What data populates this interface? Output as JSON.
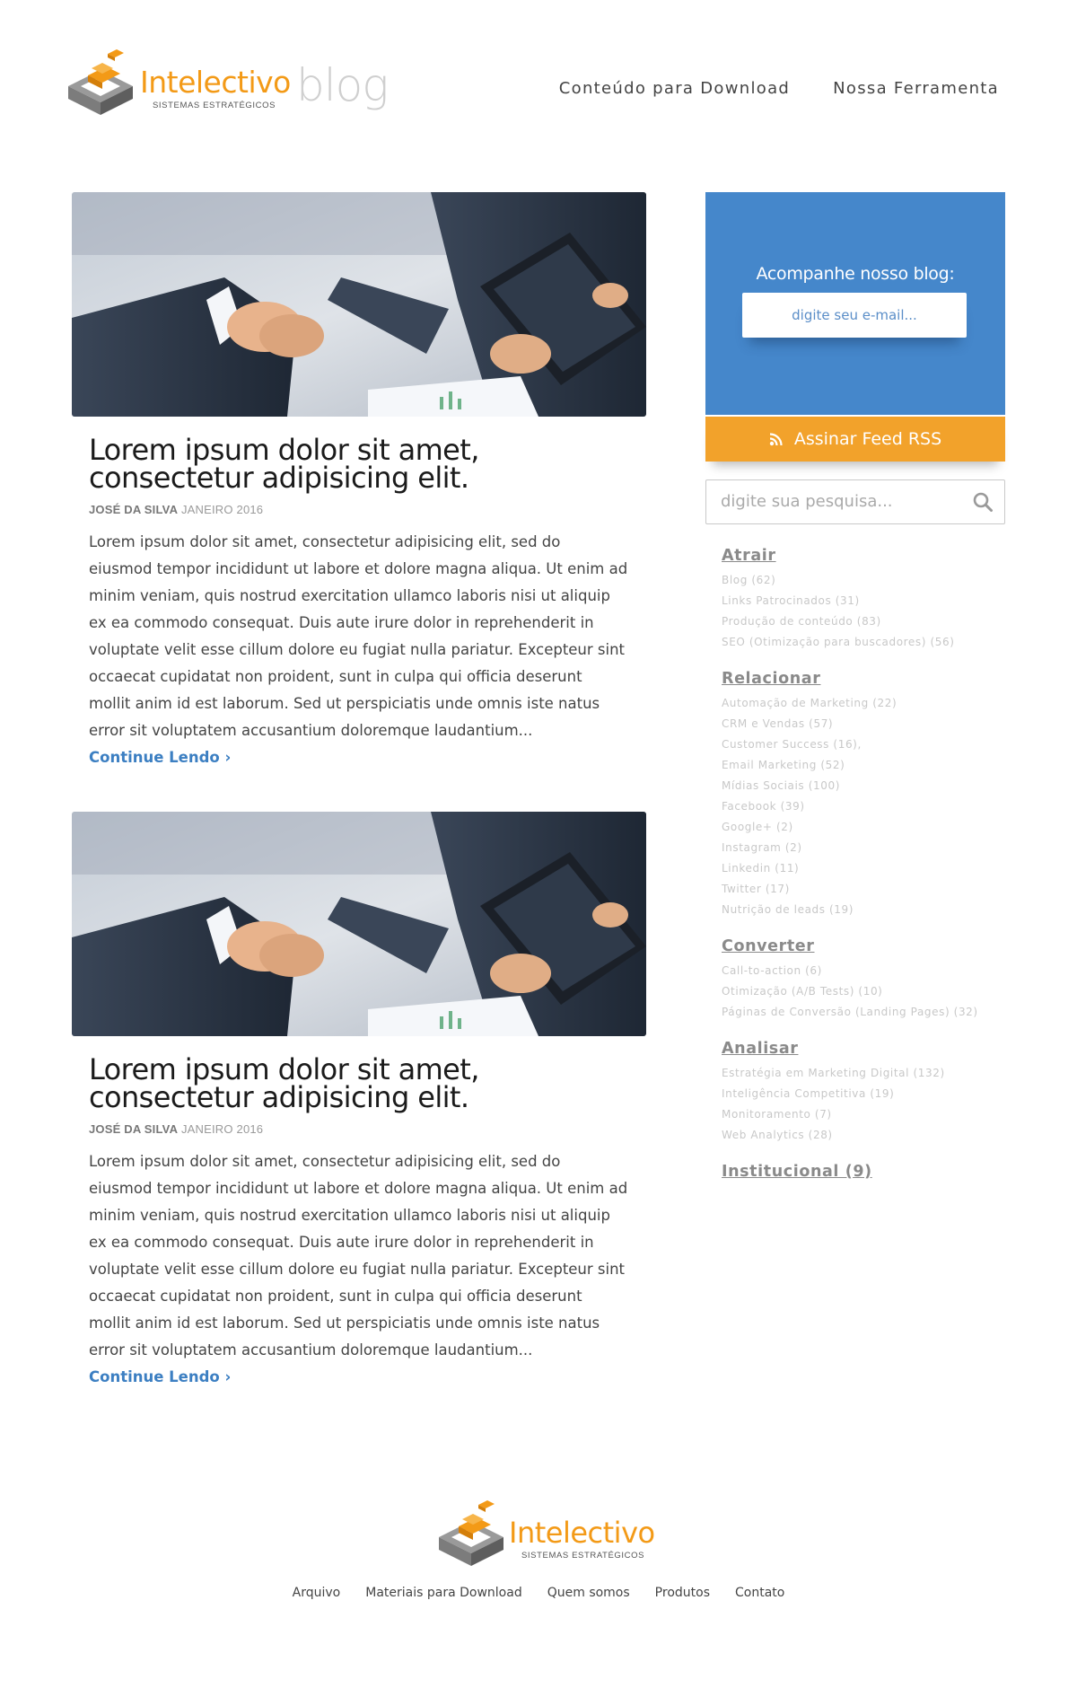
{
  "header": {
    "brand": "Intelectivo",
    "brand_tagline": "SISTEMAS ESTRATÉGICOS",
    "section": "blog",
    "nav": [
      {
        "label": "Conteúdo para Download"
      },
      {
        "label": "Nossa Ferramenta"
      }
    ]
  },
  "posts": [
    {
      "title": "Lorem ipsum dolor sit amet, consectetur adipisicing elit.",
      "author": "JOSÉ DA SILVA",
      "date": "JANEIRO 2016",
      "excerpt": "Lorem ipsum dolor sit amet, consectetur adipisicing elit, sed do eiusmod tempor incididunt ut labore et dolore magna aliqua. Ut enim ad minim veniam, quis nostrud exercitation ullamco laboris nisi ut aliquip ex ea commodo consequat. Duis aute irure dolor in reprehenderit in voluptate velit esse cillum dolore eu fugiat nulla pariatur. Excepteur sint occaecat cupidatat non proident, sunt in culpa qui officia deserunt mollit anim id est laborum. Sed ut perspiciatis unde omnis iste natus error sit voluptatem accusantium doloremque laudantium...",
      "read_more": "Continue Lendo ›",
      "image": "handshake-tablet-photo"
    },
    {
      "title": "Lorem ipsum dolor sit amet, consectetur adipisicing elit.",
      "author": "JOSÉ DA SILVA",
      "date": "JANEIRO 2016",
      "excerpt": "Lorem ipsum dolor sit amet, consectetur adipisicing elit, sed do eiusmod tempor incididunt ut labore et dolore magna aliqua. Ut enim ad minim veniam, quis nostrud exercitation ullamco laboris nisi ut aliquip ex ea commodo consequat. Duis aute irure dolor in reprehenderit in voluptate velit esse cillum dolore eu fugiat nulla pariatur. Excepteur sint occaecat cupidatat non proident, sunt in culpa qui officia deserunt mollit anim id est laborum. Sed ut perspiciatis unde omnis iste natus error sit voluptatem accusantium doloremque laudantium...",
      "read_more": "Continue Lendo ›",
      "image": "handshake-tablet-photo"
    }
  ],
  "sidebar": {
    "subscribe": {
      "title": "Acompanhe nosso blog:",
      "email_placeholder": "digite seu e-mail...",
      "email_value": ""
    },
    "rss": {
      "label": "Assinar Feed RSS",
      "icon": "rss-icon"
    },
    "search": {
      "placeholder": "digite sua pesquisa...",
      "value": "",
      "icon": "search-icon"
    },
    "categories": [
      {
        "name": "Atrair",
        "items": [
          "Blog (62)",
          "Links Patrocinados (31)",
          "Produção de conteúdo (83)",
          "SEO (Otimização para buscadores) (56)"
        ]
      },
      {
        "name": "Relacionar",
        "items": [
          "Automação de Marketing (22)",
          "CRM e Vendas (57)",
          "Customer Success (16),",
          "Email Marketing (52)",
          "Mídias Sociais (100)",
          "Facebook (39)",
          "Google+ (2)",
          "Instagram (2)",
          "Linkedin (11)",
          "Twitter (17)",
          "Nutrição de leads (19)"
        ]
      },
      {
        "name": "Converter",
        "items": [
          "Call-to-action (6)",
          "Otimização (A/B Tests) (10)",
          "Páginas de Conversão (Landing Pages) (32)"
        ]
      },
      {
        "name": "Analisar",
        "items": [
          "Estratégia em Marketing Digital (132)",
          "Inteligência Competitiva (19)",
          "Monitoramento (7)",
          "Web Analytics (28)"
        ]
      }
    ],
    "institucional": "Institucional (9)"
  },
  "footer": {
    "brand": "Intelectivo",
    "brand_tagline": "SISTEMAS ESTRATÉGICOS",
    "links": [
      {
        "label": "Arquivo"
      },
      {
        "label": "Materiais para Download"
      },
      {
        "label": "Quem somos"
      },
      {
        "label": "Produtos"
      },
      {
        "label": "Contato"
      }
    ]
  },
  "colors": {
    "brand_orange": "#f39a17",
    "subscribe_blue": "#4587cb",
    "rss_orange": "#f2a22b",
    "link_blue": "#3c7fc2"
  }
}
